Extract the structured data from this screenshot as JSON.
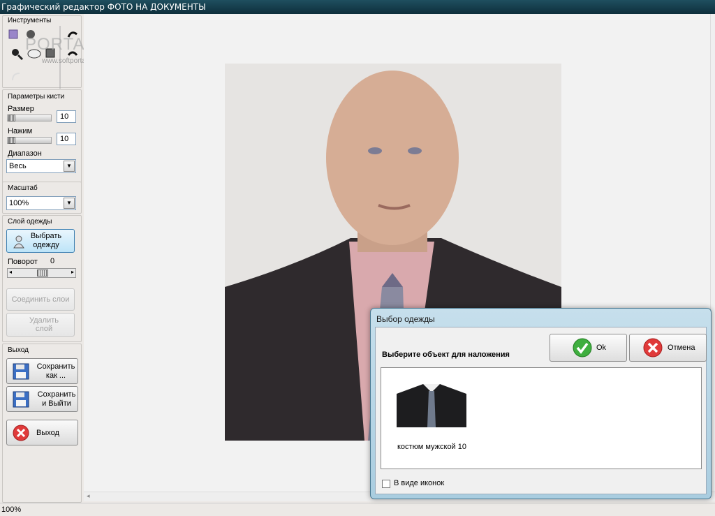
{
  "window": {
    "title": "Графический редактор ФОТО НА ДОКУМЕНТЫ"
  },
  "watermark": {
    "big": "PORTAL",
    "small": "www.softportal.com"
  },
  "tools": {
    "title": "Инструменты",
    "icons": [
      "brush-icon",
      "paint-icon",
      "undo-arrow-icon",
      "zoom-icon",
      "eraser-icon",
      "stamp-icon",
      "redo-arrow-icon",
      "lasso-icon"
    ]
  },
  "brush": {
    "title": "Параметры кисти",
    "size_label": "Размер",
    "size_value": "10",
    "pressure_label": "Нажим",
    "pressure_value": "10",
    "range_label": "Диапазон",
    "range_value": "Весь"
  },
  "zoom": {
    "title": "Масштаб",
    "value": "100%"
  },
  "clothes": {
    "title": "Слой одежды",
    "choose_label": "Выбрать одежду",
    "rotate_label": "Поворот",
    "rotate_value": "0",
    "merge_label": "Соединить слои",
    "delete_label": "Удалить слой"
  },
  "exit": {
    "title": "Выход",
    "save_as_label": "Сохранить как ...",
    "save_exit_label": "Сохранить и Выйти",
    "exit_label": "Выход"
  },
  "status": {
    "zoom": "100%"
  },
  "dialog": {
    "title": "Выбор одежды",
    "prompt": "Выберите объект для наложения",
    "ok_label": "Ok",
    "cancel_label": "Отмена",
    "items": [
      {
        "label": "костюм мужской 10"
      }
    ],
    "icons_checkbox_label": "В виде иконок"
  },
  "colors": {
    "titlebar": "#1f4f5f",
    "accent": "#3c7fb1"
  }
}
